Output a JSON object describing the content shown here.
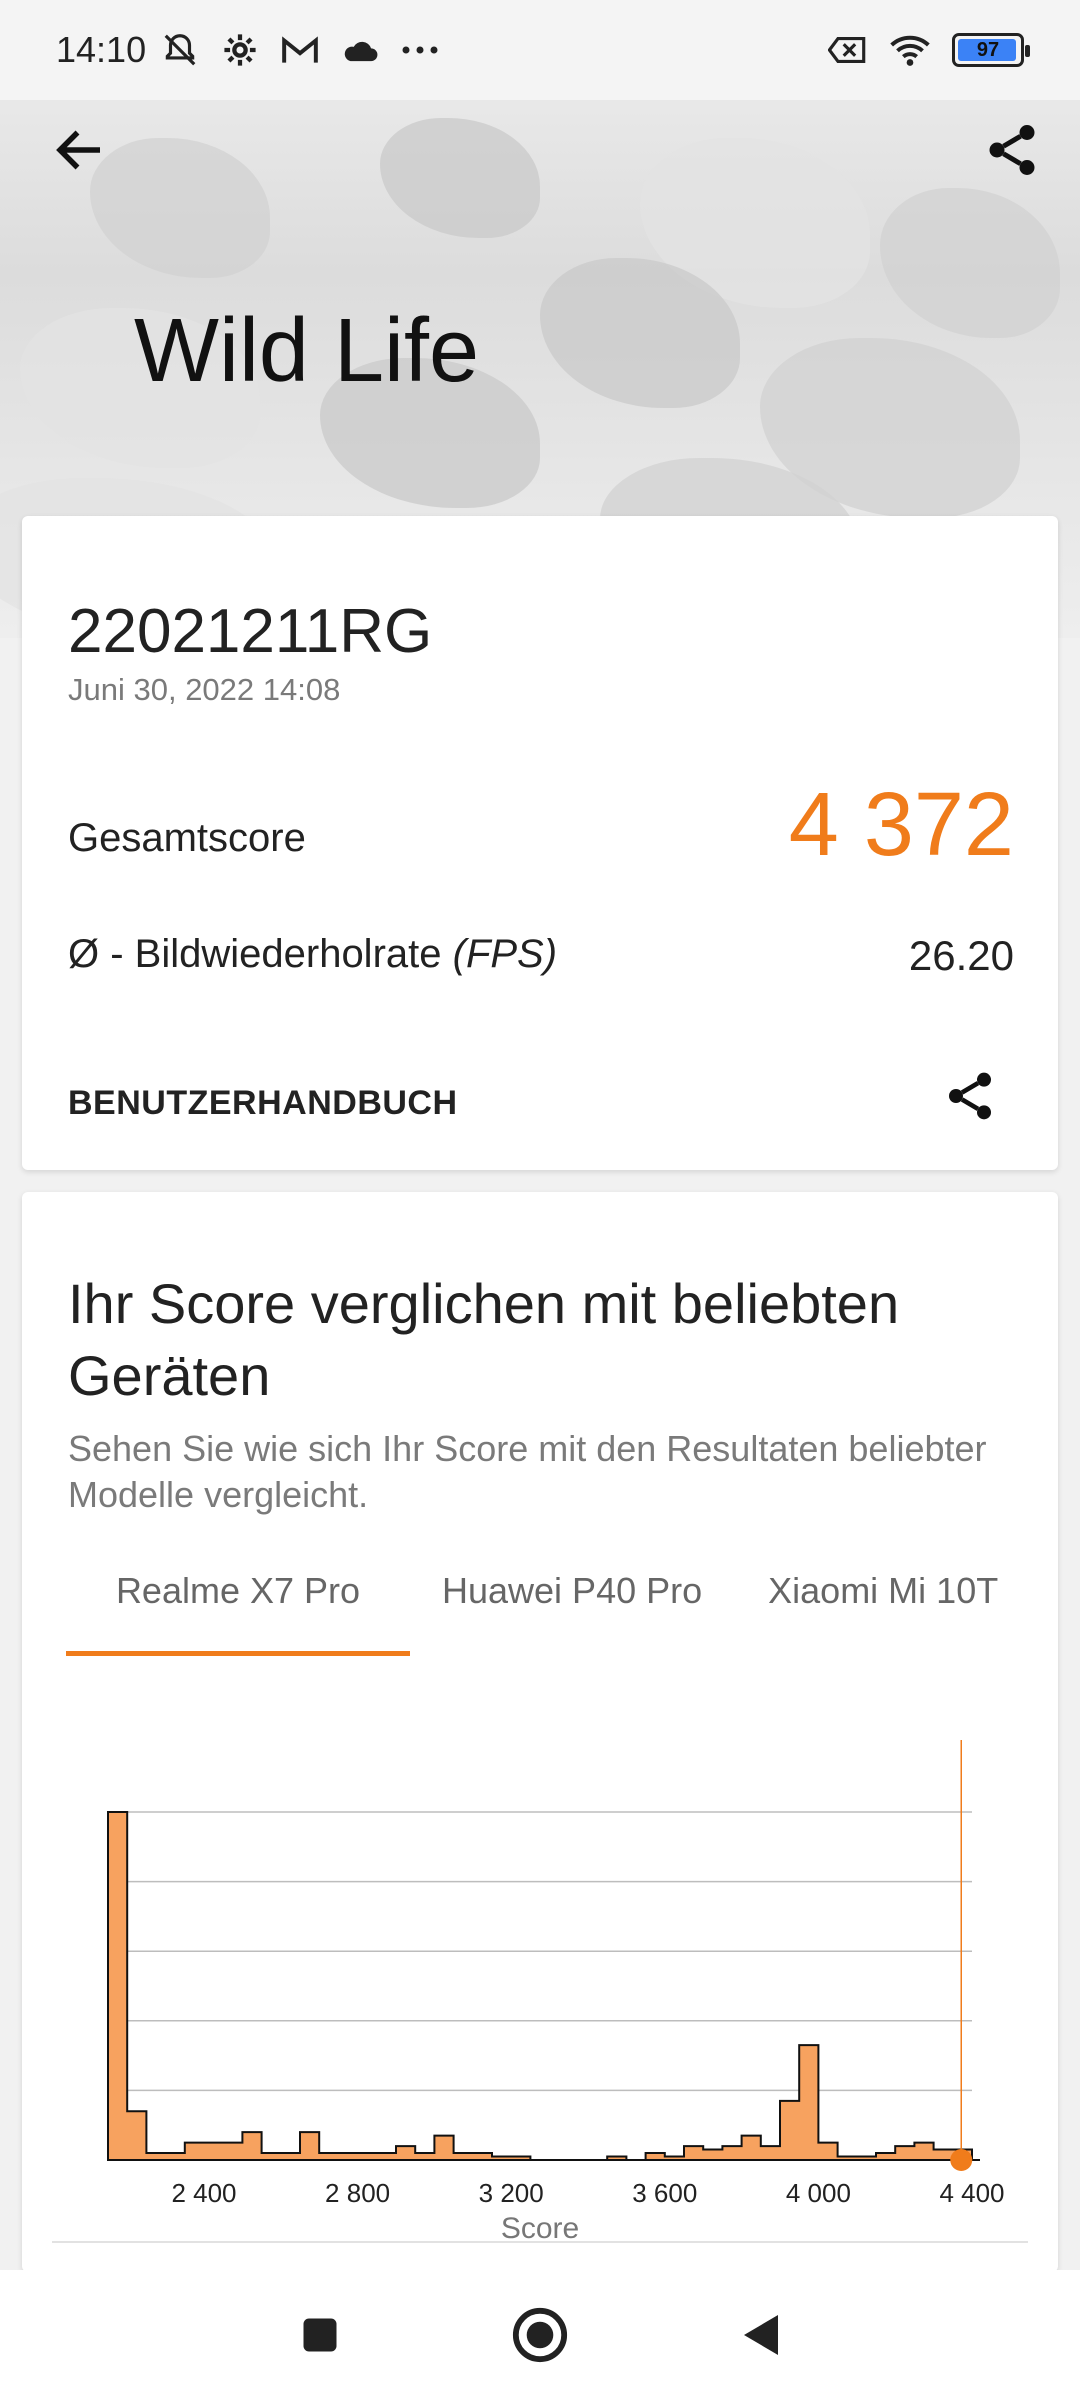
{
  "status_bar": {
    "time": "14:10",
    "battery_level": "97",
    "icons_left": [
      "notifications-muted-icon",
      "gear-icon",
      "gmail-icon",
      "cloud-icon",
      "more-icon"
    ],
    "icons_right": [
      "sim-off-icon",
      "wifi-icon",
      "battery-icon"
    ]
  },
  "header": {
    "title": "Wild Life"
  },
  "result": {
    "device": "22021211RG",
    "date": "Juni 30, 2022 14:08",
    "overall_label": "Gesamtscore",
    "overall_value": "4 372",
    "fps_label": "Ø - Bildwiederholrate",
    "fps_unit": "(FPS)",
    "fps_value": "26.20",
    "manual_label": "BENUTZERHANDBUCH"
  },
  "comparison": {
    "title": "Ihr Score verglichen mit beliebten Geräten",
    "subtitle": "Sehen Sie wie sich Ihr Score mit den Resultaten beliebter Modelle vergleicht.",
    "tabs": [
      {
        "label": "Realme X7 Pro",
        "active": true
      },
      {
        "label": "Huawei P40 Pro",
        "active": false
      },
      {
        "label": "Xiaomi Mi 10T",
        "active": false
      }
    ]
  },
  "colors": {
    "accent": "#f07c1b",
    "histogram_fill": "#f7a25f"
  },
  "chart_data": {
    "type": "area",
    "xlabel": "Score",
    "xlim": [
      2150,
      4400
    ],
    "xticks": [
      2400,
      2800,
      3200,
      3600,
      4000,
      4400
    ],
    "xtick_labels": [
      "2 400",
      "2 800",
      "3 200",
      "3 600",
      "4 000",
      "4 400"
    ],
    "bins": [
      [
        2150,
        100
      ],
      [
        2200,
        14
      ],
      [
        2250,
        2
      ],
      [
        2300,
        2
      ],
      [
        2350,
        5
      ],
      [
        2400,
        5
      ],
      [
        2450,
        5
      ],
      [
        2500,
        8
      ],
      [
        2550,
        2
      ],
      [
        2600,
        2
      ],
      [
        2650,
        8
      ],
      [
        2700,
        2
      ],
      [
        2750,
        2
      ],
      [
        2800,
        2
      ],
      [
        2850,
        2
      ],
      [
        2900,
        4
      ],
      [
        2950,
        2
      ],
      [
        3000,
        7
      ],
      [
        3050,
        2
      ],
      [
        3100,
        2
      ],
      [
        3150,
        1
      ],
      [
        3200,
        1
      ],
      [
        3250,
        0
      ],
      [
        3300,
        0
      ],
      [
        3350,
        0
      ],
      [
        3400,
        0
      ],
      [
        3450,
        1
      ],
      [
        3500,
        0
      ],
      [
        3550,
        2
      ],
      [
        3600,
        1
      ],
      [
        3650,
        4
      ],
      [
        3700,
        3
      ],
      [
        3750,
        4
      ],
      [
        3800,
        7
      ],
      [
        3850,
        4
      ],
      [
        3900,
        17
      ],
      [
        3950,
        33
      ],
      [
        4000,
        5
      ],
      [
        4050,
        1
      ],
      [
        4100,
        1
      ],
      [
        4150,
        2
      ],
      [
        4200,
        4
      ],
      [
        4250,
        5
      ],
      [
        4300,
        3
      ],
      [
        4350,
        3
      ]
    ],
    "y_gridlines": 5,
    "marker": {
      "score": 4372
    }
  }
}
